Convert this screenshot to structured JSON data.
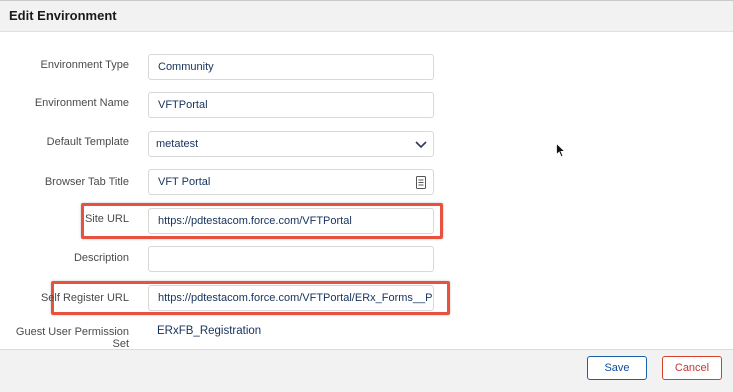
{
  "header": {
    "title": "Edit Environment"
  },
  "form": {
    "environment_type": {
      "label": "Environment Type",
      "value": "Community"
    },
    "environment_name": {
      "label": "Environment Name",
      "value": "VFTPortal"
    },
    "default_template": {
      "label": "Default Template",
      "value": "metatest"
    },
    "browser_tab_title": {
      "label": "Browser Tab Title",
      "value": "VFT Portal"
    },
    "site_url": {
      "label": "Site URL",
      "value": "https://pdtestacom.force.com/VFTPortal"
    },
    "description": {
      "label": "Description",
      "value": ""
    },
    "self_register_url": {
      "label": "Self Register URL",
      "value": "https://pdtestacom.force.com/VFTPortal/ERx_Forms__Port"
    },
    "guest_user_permission_set": {
      "label": "Guest User Permission Set",
      "value": "ERxFB_Registration"
    }
  },
  "footer": {
    "save_label": "Save",
    "cancel_label": "Cancel"
  },
  "colors": {
    "highlight": "#e7513d",
    "save": "#0b4f9c",
    "cancel": "#c23934"
  }
}
